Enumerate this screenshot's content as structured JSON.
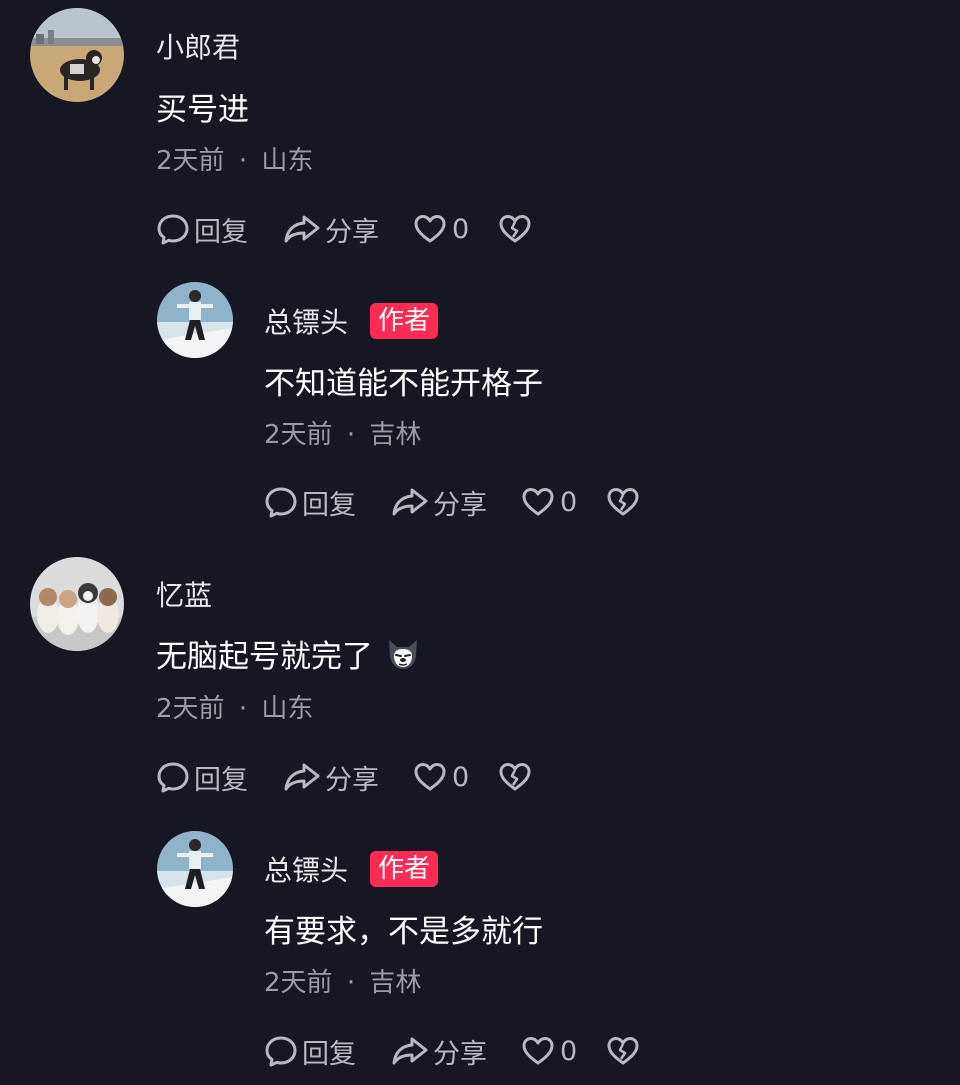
{
  "comments": [
    {
      "username": "小郎君",
      "text": "买号进",
      "time": "2天前",
      "separator": "·",
      "location": "山东",
      "reply_label": "回复",
      "share_label": "分享",
      "like_count": "0",
      "reply": {
        "username": "总镖头",
        "badge": "作者",
        "text": "不知道能不能开格子",
        "time": "2天前",
        "separator": "·",
        "location": "吉林",
        "reply_label": "回复",
        "share_label": "分享",
        "like_count": "0"
      }
    },
    {
      "username": "忆蓝",
      "text": "无脑起号就完了",
      "emoji": "husky-emoji",
      "time": "2天前",
      "separator": "·",
      "location": "山东",
      "reply_label": "回复",
      "share_label": "分享",
      "like_count": "0",
      "reply": {
        "username": "总镖头",
        "badge": "作者",
        "text": "有要求，不是多就行",
        "time": "2天前",
        "separator": "·",
        "location": "吉林",
        "reply_label": "回复",
        "share_label": "分享",
        "like_count": "0"
      }
    }
  ],
  "icons": {
    "reply": "comment-bubble-icon",
    "share": "share-arrow-icon",
    "like": "heart-icon",
    "dislike": "broken-heart-icon"
  },
  "colors": {
    "background": "#161722",
    "author_badge": "#fe2c55",
    "meta_text": "#9a9ba3",
    "action_text": "#b8b9c0"
  }
}
